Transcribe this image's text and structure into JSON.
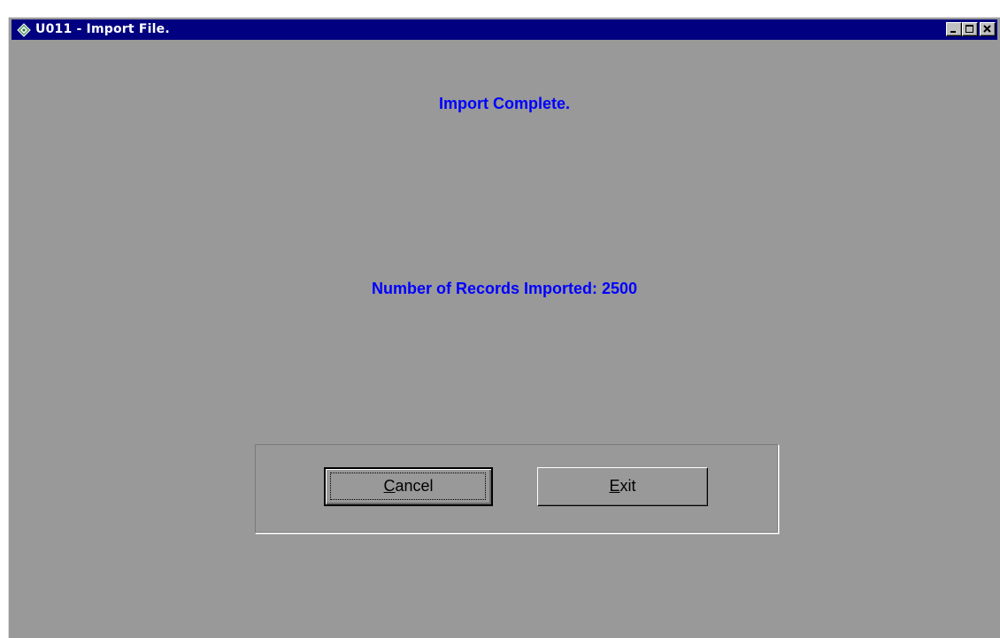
{
  "window": {
    "title": "U011 -  Import File.",
    "icon": "app-diamond-icon",
    "caption_buttons": [
      "minimize",
      "maximize",
      "close"
    ]
  },
  "messages": {
    "status": "Import Complete.",
    "records_label": "Number of Records Imported: 2500"
  },
  "buttons": {
    "cancel": {
      "label": "Cancel",
      "accelerator": "C",
      "rest": "ancel"
    },
    "exit": {
      "label": "Exit",
      "accelerator": "E",
      "rest": "xit"
    }
  },
  "colors": {
    "titlebar": "#000080",
    "background": "#999999",
    "message_text": "#0000ff"
  }
}
